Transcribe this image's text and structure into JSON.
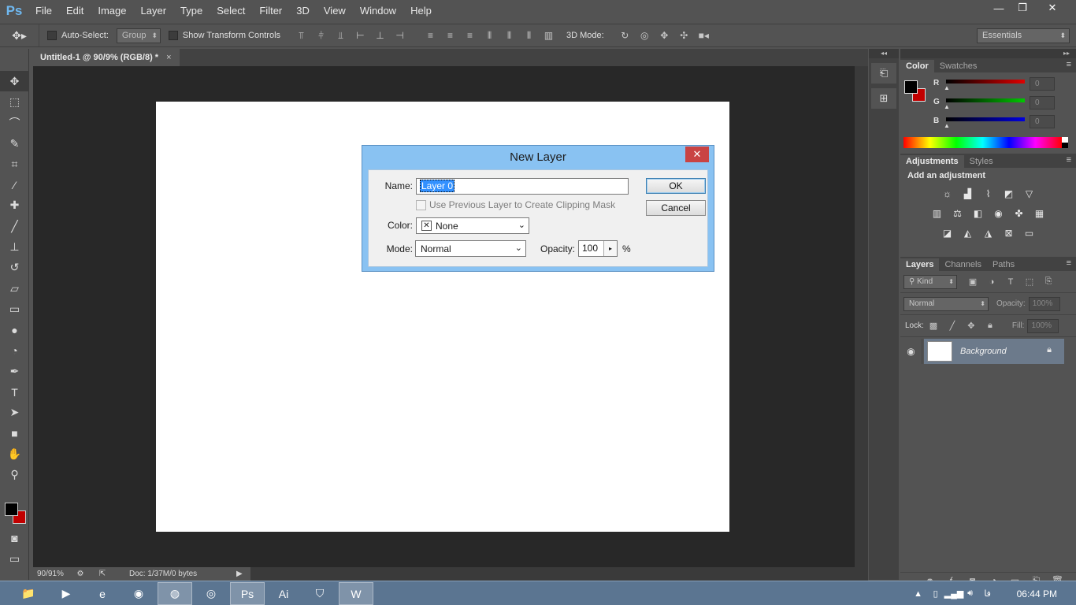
{
  "app": {
    "logo": "Ps",
    "menu": [
      "File",
      "Edit",
      "Image",
      "Layer",
      "Type",
      "Select",
      "Filter",
      "3D",
      "View",
      "Window",
      "Help"
    ],
    "window_controls": [
      "—",
      "❐",
      "✕"
    ]
  },
  "options_bar": {
    "tool_icon": "move-icon",
    "tool_glyph": "✥▸",
    "auto_select_label": "Auto-Select:",
    "auto_select_value": "Group",
    "transform_label": "Show Transform Controls",
    "mode3d_label": "3D Mode:",
    "workspace": "Essentials"
  },
  "tools": [
    {
      "name": "move-tool",
      "glyph": "✥"
    },
    {
      "name": "marquee-tool",
      "glyph": "⬚"
    },
    {
      "name": "lasso-tool",
      "glyph": "⌒"
    },
    {
      "name": "quick-selection-tool",
      "glyph": "✎"
    },
    {
      "name": "crop-tool",
      "glyph": "⌗"
    },
    {
      "name": "eyedropper-tool",
      "glyph": "⁄"
    },
    {
      "name": "healing-brush-tool",
      "glyph": "✚"
    },
    {
      "name": "brush-tool",
      "glyph": "╱"
    },
    {
      "name": "clone-stamp-tool",
      "glyph": "⊥"
    },
    {
      "name": "history-brush-tool",
      "glyph": "↺"
    },
    {
      "name": "eraser-tool",
      "glyph": "▱"
    },
    {
      "name": "gradient-tool",
      "glyph": "▭"
    },
    {
      "name": "blur-tool",
      "glyph": "●"
    },
    {
      "name": "dodge-tool",
      "glyph": "◔"
    },
    {
      "name": "pen-tool",
      "glyph": "✒"
    },
    {
      "name": "type-tool",
      "glyph": "T"
    },
    {
      "name": "path-selection-tool",
      "glyph": "➤"
    },
    {
      "name": "rectangle-tool",
      "glyph": "■"
    },
    {
      "name": "hand-tool",
      "glyph": "✋"
    },
    {
      "name": "zoom-tool",
      "glyph": "⚲"
    }
  ],
  "document": {
    "tab_title": "Untitled-1 @ 90/9% (RGB/8) *",
    "tab_close": "×",
    "zoom": "90/91%",
    "doc_info": "Doc: 1/37M/0 bytes"
  },
  "panels": {
    "color_tabs": [
      "Color",
      "Swatches"
    ],
    "color_sliders": [
      {
        "label": "R",
        "value": "0",
        "color": "#e00000"
      },
      {
        "label": "G",
        "value": "0",
        "color": "#00c800"
      },
      {
        "label": "B",
        "value": "0",
        "color": "#0000e0"
      }
    ],
    "adjust_tabs": [
      "Adjustments",
      "Styles"
    ],
    "adjust_title": "Add an adjustment",
    "layers_tabs": [
      "Layers",
      "Channels",
      "Paths"
    ],
    "layers_filter": "Kind",
    "blend_mode": "Normal",
    "opacity_label": "Opacity:",
    "opacity_value": "100%",
    "lock_label": "Lock:",
    "fill_label": "Fill:",
    "fill_value": "100%",
    "layer_name": "Background"
  },
  "dialog": {
    "title": "New Layer",
    "close": "✕",
    "name_label": "Name:",
    "name_value": "Layer 0",
    "clip_label": "Use Previous Layer to Create Clipping Mask",
    "color_label": "Color:",
    "color_value": "None",
    "mode_label": "Mode:",
    "mode_value": "Normal",
    "opacity_label": "Opacity:",
    "opacity_value": "100",
    "percent": "%",
    "ok": "OK",
    "cancel": "Cancel"
  },
  "taskbar": {
    "apps": [
      {
        "name": "file-explorer",
        "glyph": "📁"
      },
      {
        "name": "media-player",
        "glyph": "▶"
      },
      {
        "name": "internet-explorer",
        "glyph": "e"
      },
      {
        "name": "chrome",
        "glyph": "◉"
      },
      {
        "name": "firefox",
        "glyph": "◍"
      },
      {
        "name": "blender",
        "glyph": "◎"
      },
      {
        "name": "photoshop",
        "glyph": "Ps"
      },
      {
        "name": "illustrator",
        "glyph": "Ai"
      },
      {
        "name": "shield-app",
        "glyph": "⛉"
      },
      {
        "name": "word",
        "glyph": "W"
      }
    ],
    "lang": "فا",
    "clock": "06:44 PM"
  }
}
